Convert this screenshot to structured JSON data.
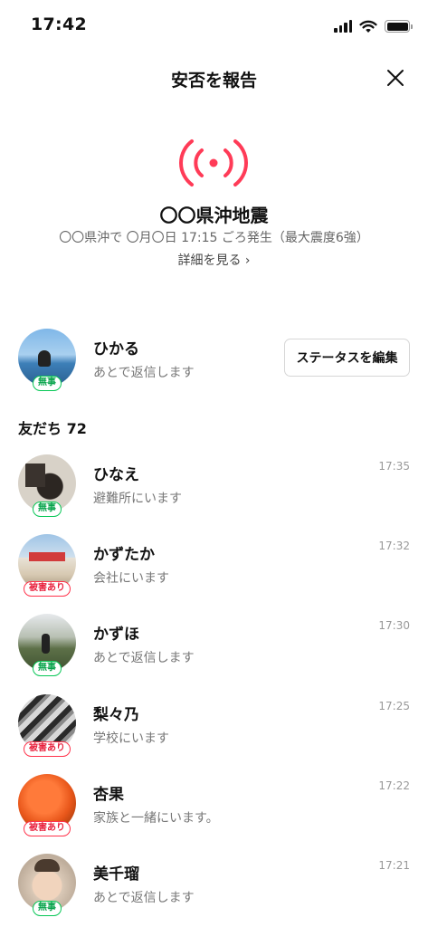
{
  "status_bar": {
    "time": "17:42"
  },
  "header": {
    "title": "安否を報告"
  },
  "event": {
    "title": "〇〇県沖地震",
    "subtitle": "〇〇県沖で 〇月〇日 17:15 ごろ発生（最大震度6強）",
    "details_link": "詳細を見る ›"
  },
  "me": {
    "name": "ひかる",
    "status": "あとで返信します",
    "badge": "無事",
    "edit_button": "ステータスを編集"
  },
  "friends": {
    "header": "友だち 72",
    "items": [
      {
        "name": "ひなえ",
        "status": "避難所にいます",
        "time": "17:35",
        "badge": "無事"
      },
      {
        "name": "かずたか",
        "status": "会社にいます",
        "time": "17:32",
        "badge": "被害あり"
      },
      {
        "name": "かずほ",
        "status": "あとで返信します",
        "time": "17:30",
        "badge": "無事"
      },
      {
        "name": "梨々乃",
        "status": "学校にいます",
        "time": "17:25",
        "badge": "被害あり"
      },
      {
        "name": "杏果",
        "status": "家族と一緒にいます。",
        "time": "17:22",
        "badge": "被害あり"
      },
      {
        "name": "美千瑠",
        "status": "あとで返信します",
        "time": "17:21",
        "badge": "無事"
      }
    ]
  },
  "colors": {
    "safe": "#06c755",
    "damage": "#ff334b",
    "broadcast": "#ff3b57"
  }
}
